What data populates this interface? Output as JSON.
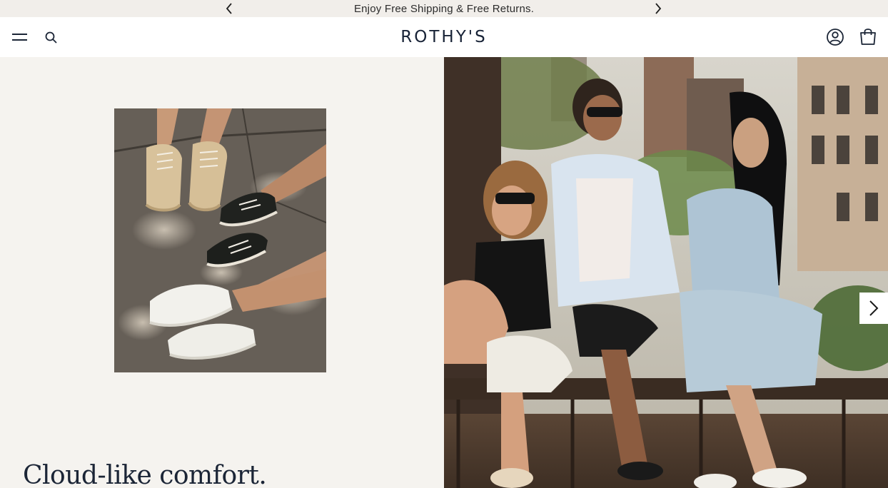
{
  "announcement": {
    "text": "Enjoy Free Shipping & Free Returns.",
    "prev_icon": "chevron-left-icon",
    "next_icon": "chevron-right-icon"
  },
  "header": {
    "logo": "ROTHY'S",
    "menu_icon": "hamburger-menu-icon",
    "search_icon": "search-icon",
    "account_icon": "account-icon",
    "cart_icon": "shopping-bag-icon"
  },
  "hero": {
    "headline": "Cloud-like comfort.",
    "next_slide_icon": "chevron-right-icon"
  },
  "colors": {
    "background": "#f5f3ef",
    "header_bg": "#ffffff",
    "brand_navy": "#172236"
  }
}
